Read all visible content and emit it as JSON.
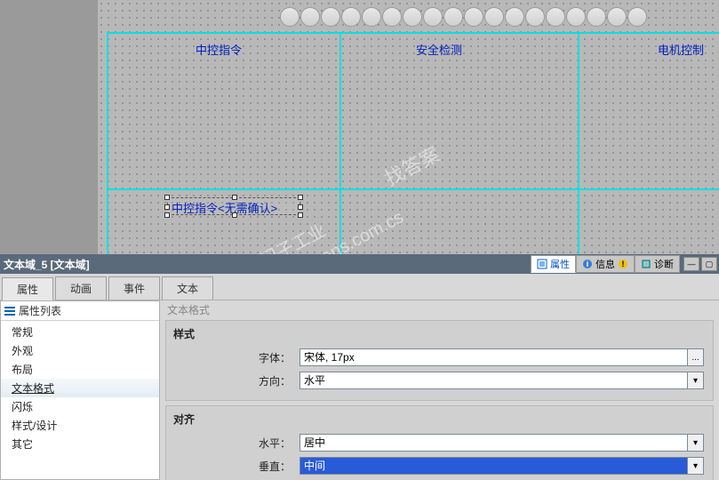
{
  "canvas": {
    "labels": {
      "zhongkong": "中控指令",
      "anquan": "安全检测",
      "dianji": "电机控制",
      "selected": "中控指令<无需确认>"
    }
  },
  "watermark": {
    "line1": "找答案",
    "line2": "support.industry.siemens.com.cs",
    "line3": "西门子工业"
  },
  "titlebar": {
    "title": "文本域_5 [文本域]",
    "tabs": {
      "properties": "属性",
      "info": "信息",
      "diag": "诊断"
    }
  },
  "mainTabs": {
    "properties": "属性",
    "animation": "动画",
    "events": "事件",
    "text": "文本"
  },
  "propList": {
    "header": "属性列表",
    "items": [
      "常规",
      "外观",
      "布局",
      "文本格式",
      "闪烁",
      "样式/设计",
      "其它"
    ],
    "selectedIndex": 3
  },
  "content": {
    "crumb": "文本格式",
    "group_style": "样式",
    "group_align": "对齐",
    "field_font_label": "字体：",
    "field_font_value": "宋体, 17px",
    "field_dir_label": "方向：",
    "field_dir_value": "水平",
    "field_halign_label": "水平：",
    "field_halign_value": "居中",
    "field_valign_label": "垂直：",
    "field_valign_value": "中间",
    "ellipsis": "..."
  }
}
